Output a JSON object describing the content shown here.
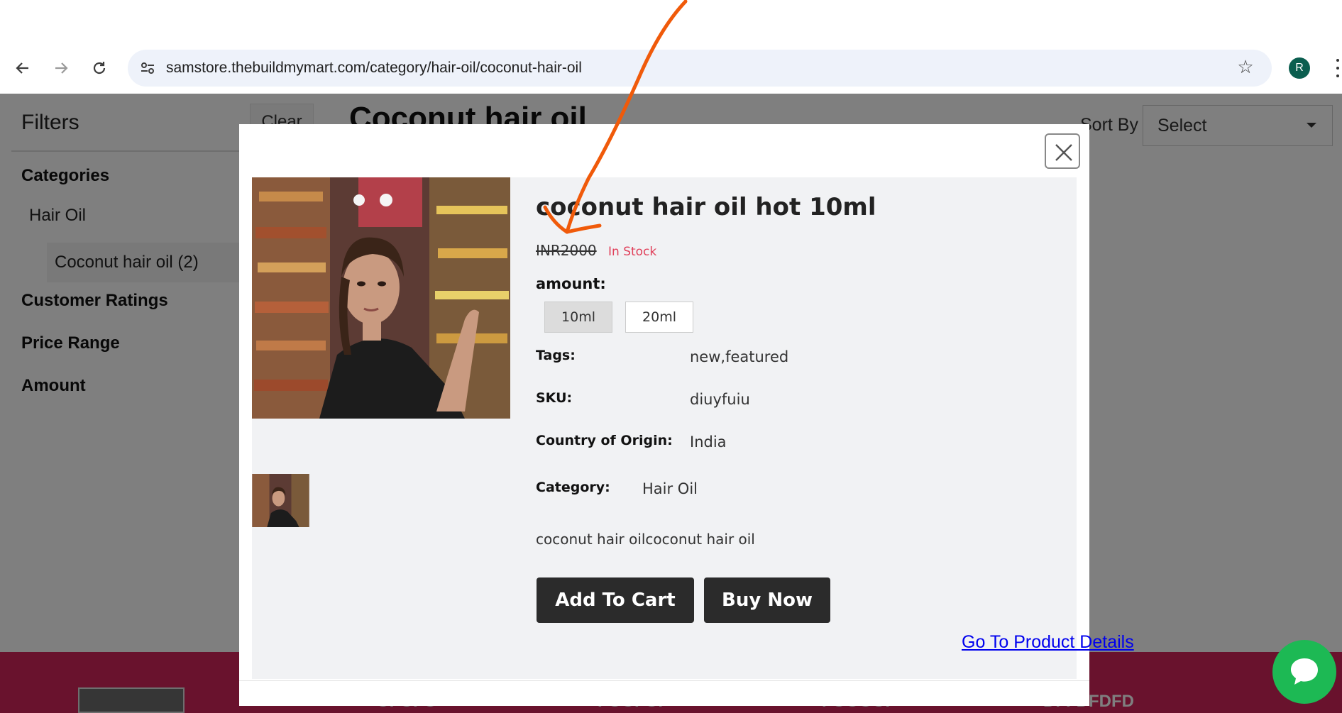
{
  "browser": {
    "url": "samstore.thebuildmymart.com/category/hair-oil/coconut-hair-oil",
    "profile_initial": "R"
  },
  "page": {
    "filters_title": "Filters",
    "clear_label": "Clear",
    "heading": "Coconut hair oil",
    "categories_label": "Categories",
    "category_item": "Hair Oil",
    "subcategory_item": "Coconut hair oil (2)",
    "customer_ratings_label": "Customer Ratings",
    "price_range_label": "Price Range",
    "amount_label": "Amount",
    "sort_by_label": "Sort By",
    "sort_select_value": "Select",
    "footer_items": [
      "GFGFG",
      "FGGFGF",
      "FGGGGF",
      "DFFDFDFD"
    ]
  },
  "modal": {
    "title": "coconut hair oil hot 10ml",
    "price": "INR2000",
    "stock_status": "In Stock",
    "amount_label": "amount:",
    "amount_options": [
      {
        "label": "10ml",
        "selected": true
      },
      {
        "label": "20ml",
        "selected": false
      }
    ],
    "tags_label": "Tags:",
    "tags_value": "new,featured",
    "sku_label": "SKU:",
    "sku_value": "diuyfuiu",
    "origin_label": "Country of Origin:",
    "origin_value": "India",
    "category_label": "Category:",
    "category_value": "Hair Oil",
    "description": "coconut hair oilcoconut hair oil",
    "add_to_cart_label": "Add To Cart",
    "buy_now_label": "Buy Now",
    "details_link": "Go To Product Details"
  },
  "colors": {
    "annotation_arrow": "#f05a0a",
    "footer": "#d3255a",
    "stock": "#e0405a",
    "chat": "#1db954"
  }
}
